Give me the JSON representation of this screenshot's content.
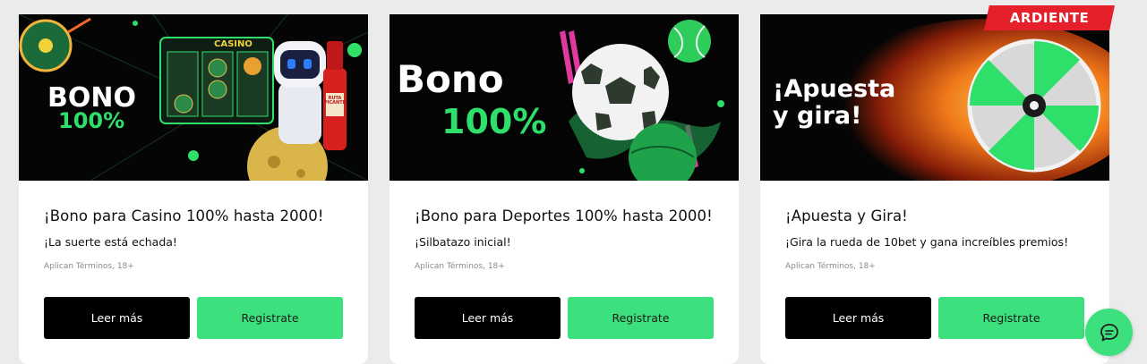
{
  "colors": {
    "accent_green": "#3ce07d",
    "button_dark": "#000000",
    "badge_red": "#e6202b",
    "page_bg": "#ebebeb"
  },
  "cards": [
    {
      "banner": {
        "line1": "BONO",
        "line2": "100%",
        "slot_label": "CASINO",
        "sauce_label": "RUTA PICANTE"
      },
      "title": "¡Bono para Casino 100% hasta 2000!",
      "subtitle": "¡La suerte está echada!",
      "terms": "Aplican Términos, 18+",
      "btn_more": "Leer más",
      "btn_register": "Registrate"
    },
    {
      "banner": {
        "line1": "Bono",
        "line2": "100%"
      },
      "title": "¡Bono para Deportes 100% hasta 2000!",
      "subtitle": "¡Silbatazo inicial!",
      "terms": "Aplican Términos, 18+",
      "btn_more": "Leer más",
      "btn_register": "Registrate"
    },
    {
      "badge": "ARDIENTE",
      "banner": {
        "line1": "¡Apuesta",
        "line2": "y gira!"
      },
      "title": "¡Apuesta y Gira!",
      "subtitle": "¡Gira la rueda de 10bet y gana increíbles premios!",
      "terms": "Aplican Términos, 18+",
      "btn_more": "Leer más",
      "btn_register": "Registrate"
    }
  ],
  "chat": {
    "icon": "chat-bubble-icon"
  }
}
